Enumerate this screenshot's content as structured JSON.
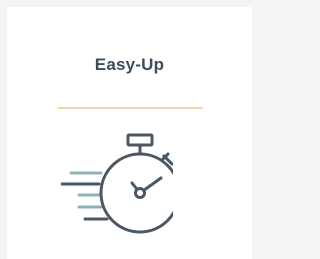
{
  "card": {
    "title": "Easy-Up",
    "icon": "stopwatch-speed-icon"
  },
  "colors": {
    "page_background": "#f5f4f2",
    "card_background": "#ffffff",
    "title_text": "#3d4c5c",
    "divider": "#f0d9a8",
    "icon_stroke": "#4a5866",
    "icon_accent": "#8fb2b4"
  }
}
